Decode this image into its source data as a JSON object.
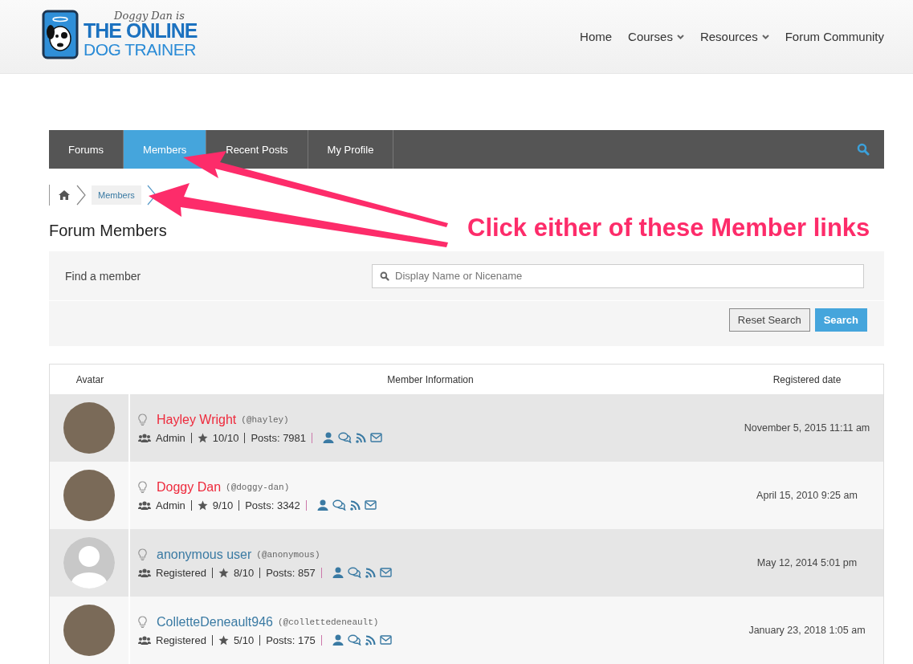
{
  "logo": {
    "tagline": "Doggy Dan is",
    "line_1": "THE ONLINE",
    "line_2": "DOG TRAINER"
  },
  "nav": [
    {
      "label": "Home",
      "has_menu": false
    },
    {
      "label": "Courses",
      "has_menu": true
    },
    {
      "label": "Resources",
      "has_menu": true
    },
    {
      "label": "Forum Community",
      "has_menu": false
    }
  ],
  "forum_tabs": [
    {
      "label": "Forums",
      "selected": false
    },
    {
      "label": "Members",
      "selected": true
    },
    {
      "label": "Recent Posts",
      "selected": false
    },
    {
      "label": "My Profile",
      "selected": false
    }
  ],
  "breadcrumb": [
    "Members"
  ],
  "heading": "Forum Members",
  "search": {
    "label": "Find a member",
    "placeholder": "Display Name or Nicename",
    "buttons": [
      {
        "label": "Reset Search",
        "kind": "secondary"
      },
      {
        "label": "Search",
        "kind": "primary"
      }
    ]
  },
  "table": {
    "columns": [
      "Avatar",
      "Member Information",
      "Registered date"
    ],
    "rows": [
      {
        "kind": "photo",
        "name": "Hayley Wright",
        "color": "#ee2a3c",
        "handle": "(@hayley)",
        "role": "Admin",
        "rating": "10/10",
        "posts": "Posts: 7981",
        "registered": "November 5, 2015 11:11 am"
      },
      {
        "kind": "photo",
        "name": "Doggy Dan",
        "color": "#ee2a3c",
        "handle": "(@doggy-dan)",
        "role": "Admin",
        "rating": "9/10",
        "posts": "Posts: 3342",
        "registered": "April 15, 2010 9:25 am"
      },
      {
        "kind": "default",
        "name": "anonymous user",
        "color": "#3a7aa3",
        "handle": "(@anonymous)",
        "role": "Registered",
        "rating": "8/10",
        "posts": "Posts: 857",
        "registered": "May 12, 2014 5:01 pm"
      },
      {
        "kind": "photo",
        "name": "ColletteDeneault946",
        "color": "#3a7aa3",
        "handle": "(@collettedeneault)",
        "role": "Registered",
        "rating": "5/10",
        "posts": "Posts: 175",
        "registered": "January 23, 2018 1:05 am"
      }
    ]
  },
  "annotation": {
    "text": "Click either of these Member links"
  }
}
